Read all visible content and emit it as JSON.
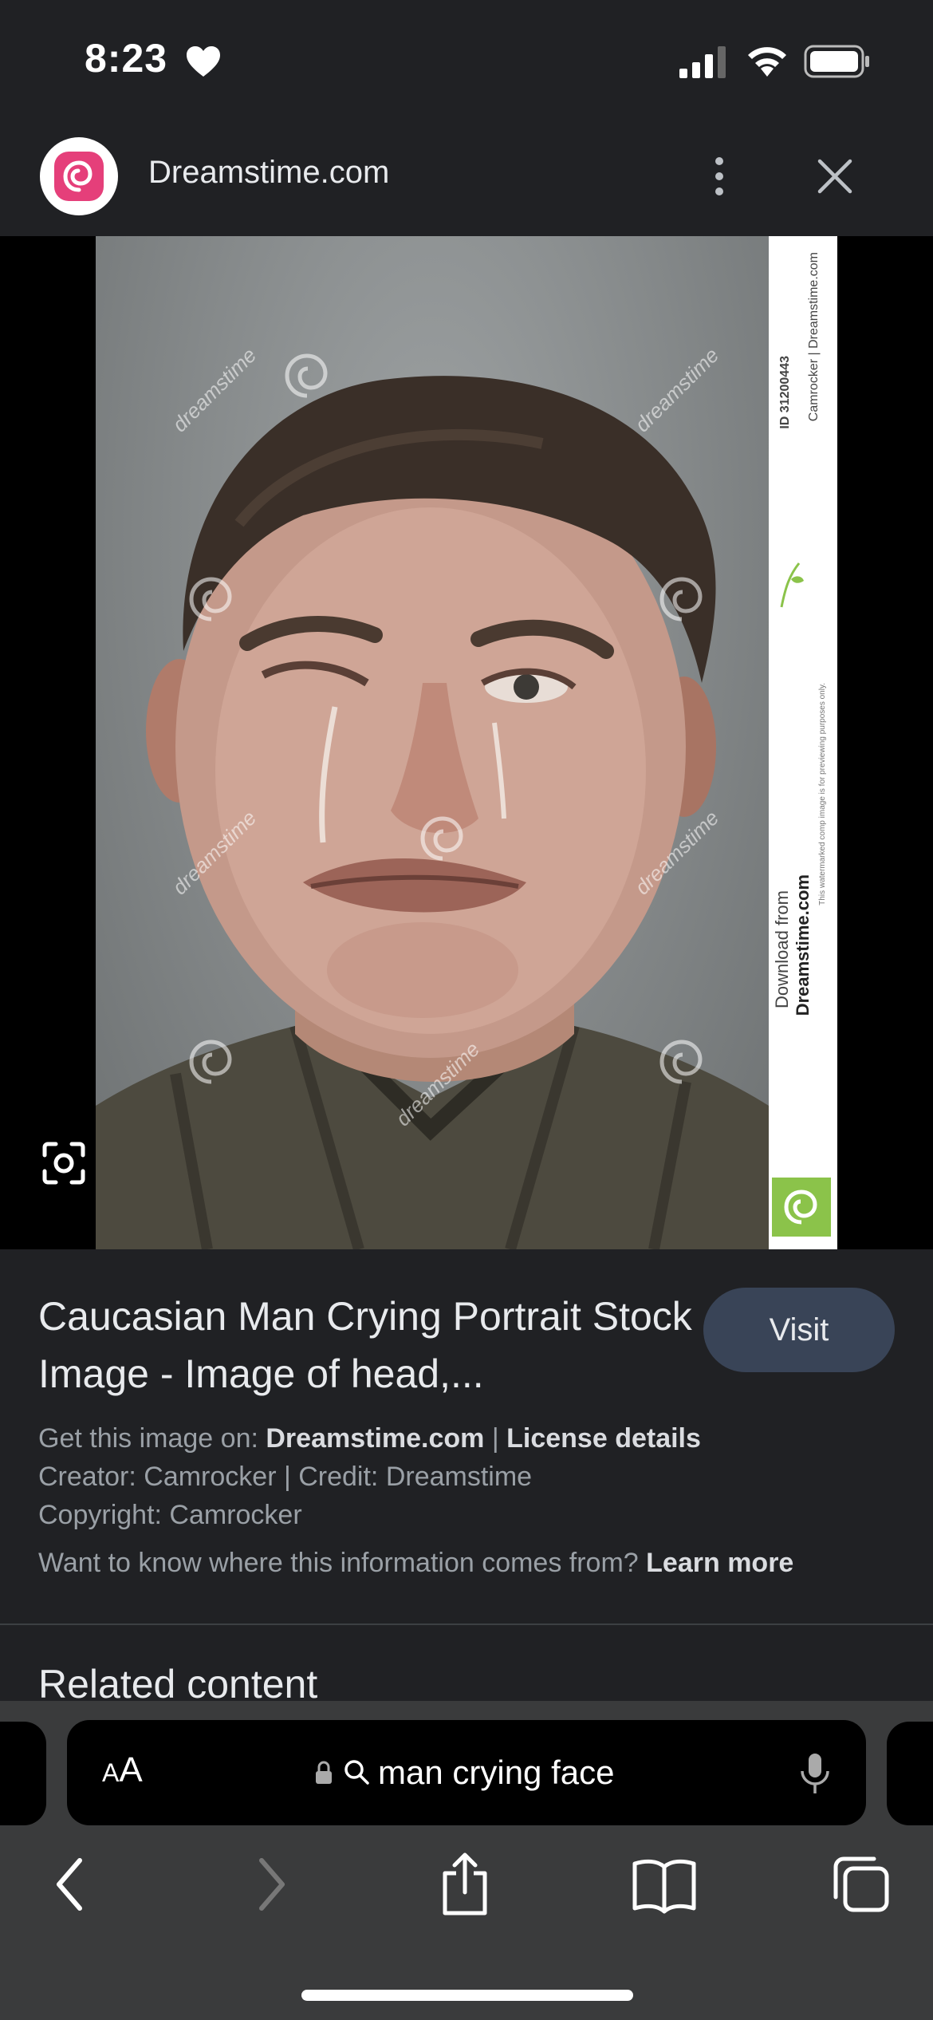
{
  "status_bar": {
    "time": "8:23",
    "icons": [
      "heart-icon",
      "cellular-signal-icon",
      "wifi-icon",
      "battery-icon"
    ]
  },
  "top_bar": {
    "site_name": "Dreamstime.com",
    "logo_icon": "dreamstime-logo-icon",
    "more_icon": "more-vert-icon",
    "close_icon": "close-icon",
    "brand_color": "#e53f7a"
  },
  "image": {
    "watermark_text": "dreamstime",
    "strip": {
      "id_label": "ID 31200443",
      "credit": "Camrocker | Dreamstime.com",
      "download_line1": "Download from",
      "download_line2": "Dreamstime.com",
      "notice": "This watermarked comp image is for previewing purposes only."
    },
    "lens_icon": "google-lens-icon"
  },
  "info": {
    "title": "Caucasian Man Crying Portrait Stock Image - Image of head,...",
    "visit_label": "Visit",
    "get_image_prefix": "Get this image on: ",
    "get_image_site": "Dreamstime.com",
    "separator": " | ",
    "license_details": "License details",
    "creator_line": "Creator: Camrocker | Credit: Dreamstime",
    "copyright_line": "Copyright: Camrocker",
    "info_question": "Want to know where this information comes from? ",
    "learn_more": "Learn more",
    "related_heading": "Related content"
  },
  "safari": {
    "aa_small": "A",
    "aa_large": "A",
    "search_query": "man crying face",
    "nav_icons": [
      "back-icon",
      "forward-icon",
      "share-icon",
      "bookmarks-icon",
      "tabs-icon"
    ],
    "url_bar_bg": "#000000",
    "toolbar_bg": "#3a3b3c"
  }
}
